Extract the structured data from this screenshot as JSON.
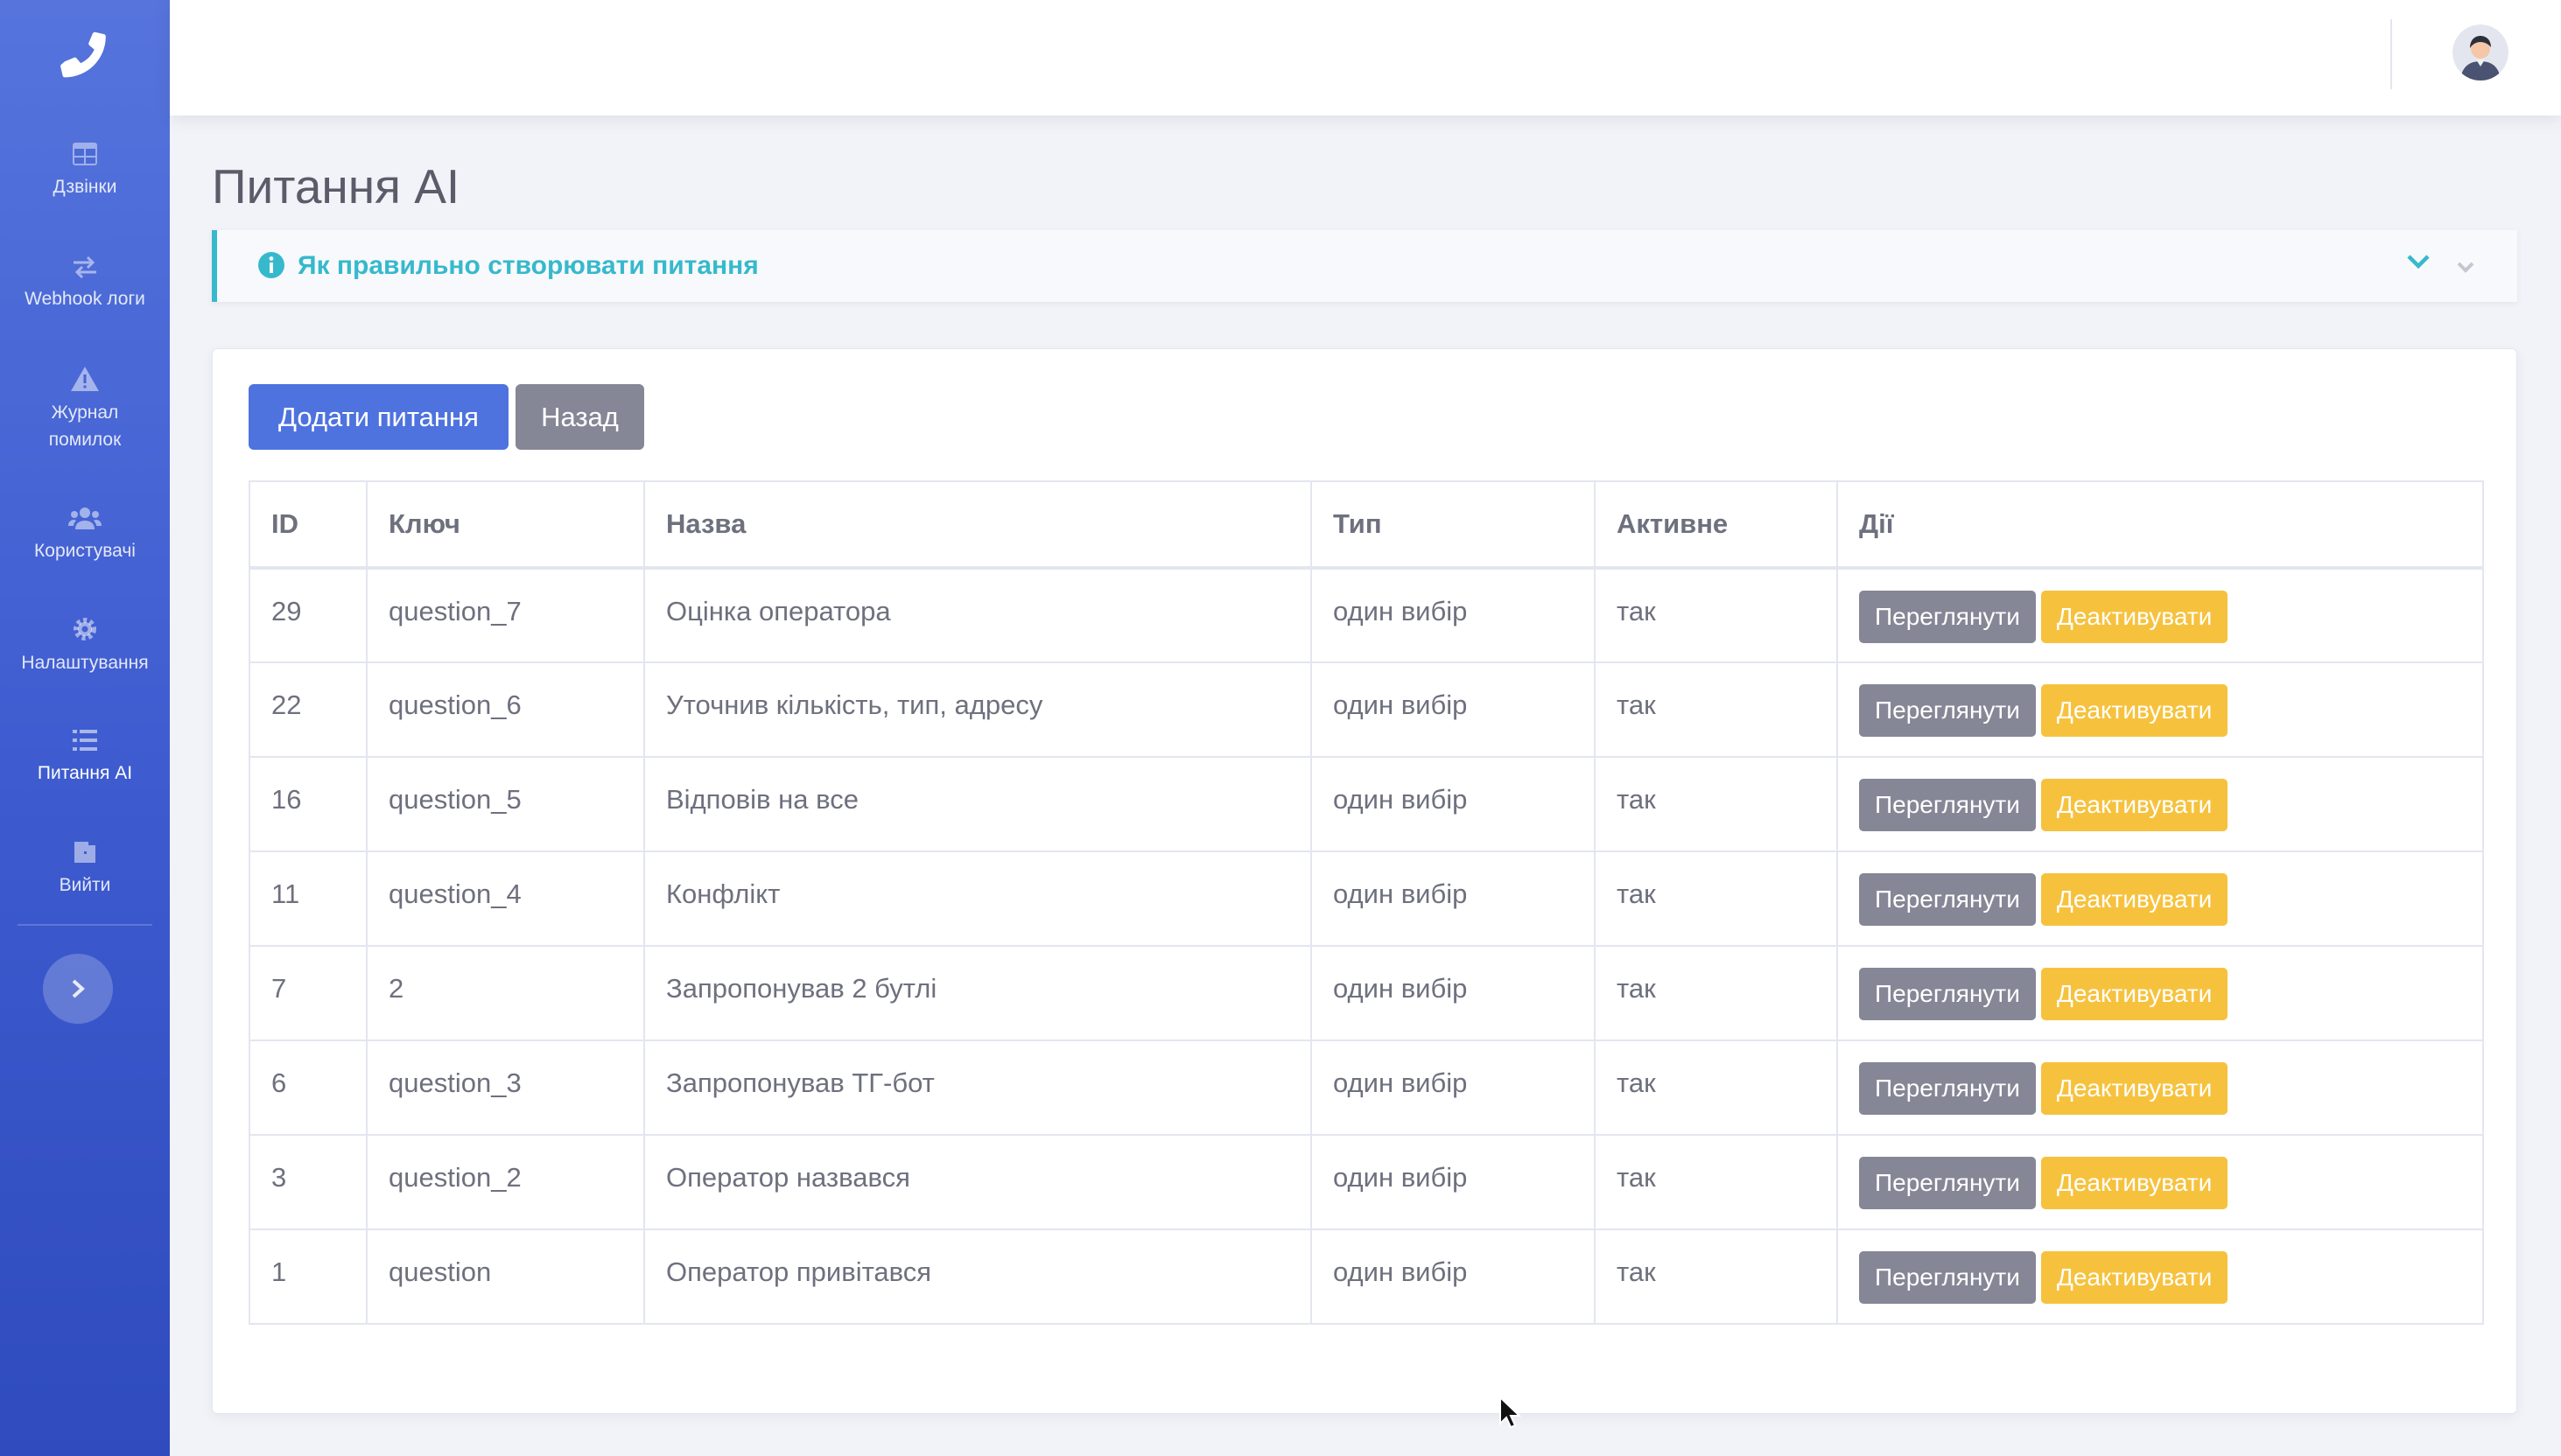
{
  "sidebar": {
    "brand_icon": "phone-icon",
    "items": [
      {
        "label": "Дзвінки",
        "icon": "table-icon"
      },
      {
        "label": "Webhook логи",
        "icon": "exchange-icon"
      },
      {
        "label": "Журнал помилок",
        "icon": "warning-icon"
      },
      {
        "label": "Користувачі",
        "icon": "users-icon"
      },
      {
        "label": "Налаштування",
        "icon": "gear-icon"
      },
      {
        "label": "Питання AI",
        "icon": "list-icon"
      },
      {
        "label": "Вийти",
        "icon": "door-icon"
      }
    ],
    "toggle_icon": "chevron-right-icon"
  },
  "page": {
    "title": "Питання AI",
    "info": {
      "title": "Як правильно створювати питання"
    }
  },
  "toolbar": {
    "add_label": "Додати питання",
    "back_label": "Назад"
  },
  "table": {
    "headers": [
      "ID",
      "Ключ",
      "Назва",
      "Тип",
      "Активне",
      "Дії"
    ],
    "rows": [
      [
        "29",
        "question_7",
        "Оцінка оператора",
        "один вибір",
        "так"
      ],
      [
        "22",
        "question_6",
        "Уточнив кількість, тип, адресу",
        "один вибір",
        "так"
      ],
      [
        "16",
        "question_5",
        "Відповів на все",
        "один вибір",
        "так"
      ],
      [
        "11",
        "question_4",
        "Конфлікт",
        "один вибір",
        "так"
      ],
      [
        "7",
        "2",
        "Запропонував 2 бутлі",
        "один вибір",
        "так"
      ],
      [
        "6",
        "question_3",
        "Запропонував ТГ-бот",
        "один вибір",
        "так"
      ],
      [
        "3",
        "question_2",
        "Оператор назвався",
        "один вибір",
        "так"
      ],
      [
        "1",
        "question",
        "Оператор привітався",
        "один вибір",
        "так"
      ]
    ],
    "actions": {
      "view": "Переглянути",
      "deactivate": "Деактивувати"
    }
  },
  "colors": {
    "primary": "#4e73df",
    "secondary": "#858796",
    "warning": "#f6c23e",
    "info": "#36b9cc"
  }
}
